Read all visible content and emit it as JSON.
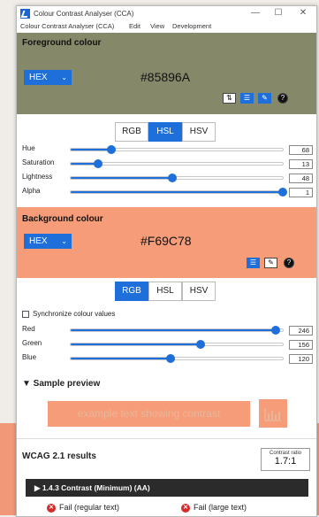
{
  "window": {
    "title": "Colour Contrast Analyser (CCA)",
    "controls": {
      "minimize": "—",
      "maximize": "☐",
      "close": "✕"
    }
  },
  "menu": {
    "items": [
      "Colour Contrast Analyser (CCA)",
      "Edit",
      "View",
      "Development"
    ]
  },
  "foreground": {
    "title": "Foreground colour",
    "format": "HEX",
    "hex": "#85896A",
    "color": "#85896a",
    "tools": [
      "swap-icon",
      "sliders-icon",
      "eyedropper-icon",
      "help-icon"
    ],
    "tabs": [
      "RGB",
      "HSL",
      "HSV"
    ],
    "selected_tab": "HSL",
    "sliders": [
      {
        "label": "Hue",
        "value": "68",
        "fraction": 0.19
      },
      {
        "label": "Saturation",
        "value": "13",
        "fraction": 0.13
      },
      {
        "label": "Lightness",
        "value": "48",
        "fraction": 0.48
      },
      {
        "label": "Alpha",
        "value": "1",
        "fraction": 1.0
      }
    ]
  },
  "background": {
    "title": "Background colour",
    "format": "HEX",
    "hex": "#F69C78",
    "color": "#f69c78",
    "tools": [
      "sliders-icon",
      "eyedropper-icon",
      "help-icon"
    ],
    "tabs": [
      "RGB",
      "HSL",
      "HSV"
    ],
    "selected_tab": "RGB",
    "sync_label": "Synchronize colour values",
    "sync_checked": false,
    "sliders": [
      {
        "label": "Red",
        "value": "246",
        "fraction": 0.965
      },
      {
        "label": "Green",
        "value": "156",
        "fraction": 0.612
      },
      {
        "label": "Blue",
        "value": "120",
        "fraction": 0.471
      }
    ]
  },
  "preview": {
    "title": "▼ Sample preview",
    "sample_text": "example text showing contrast",
    "icon": "chart-icon"
  },
  "wcag": {
    "title": "WCAG 2.1 results",
    "ratio_label": "Contrast ratio",
    "ratio_value": "1.7:1",
    "criterion": "▶  1.4.3 Contrast (Minimum) (AA)",
    "results": [
      {
        "label": "Fail (regular text)",
        "status": "fail"
      },
      {
        "label": "Fail (large text)",
        "status": "fail"
      }
    ]
  },
  "colors": {
    "accent": "#1e6fd9",
    "fail": "#d42b2b"
  }
}
